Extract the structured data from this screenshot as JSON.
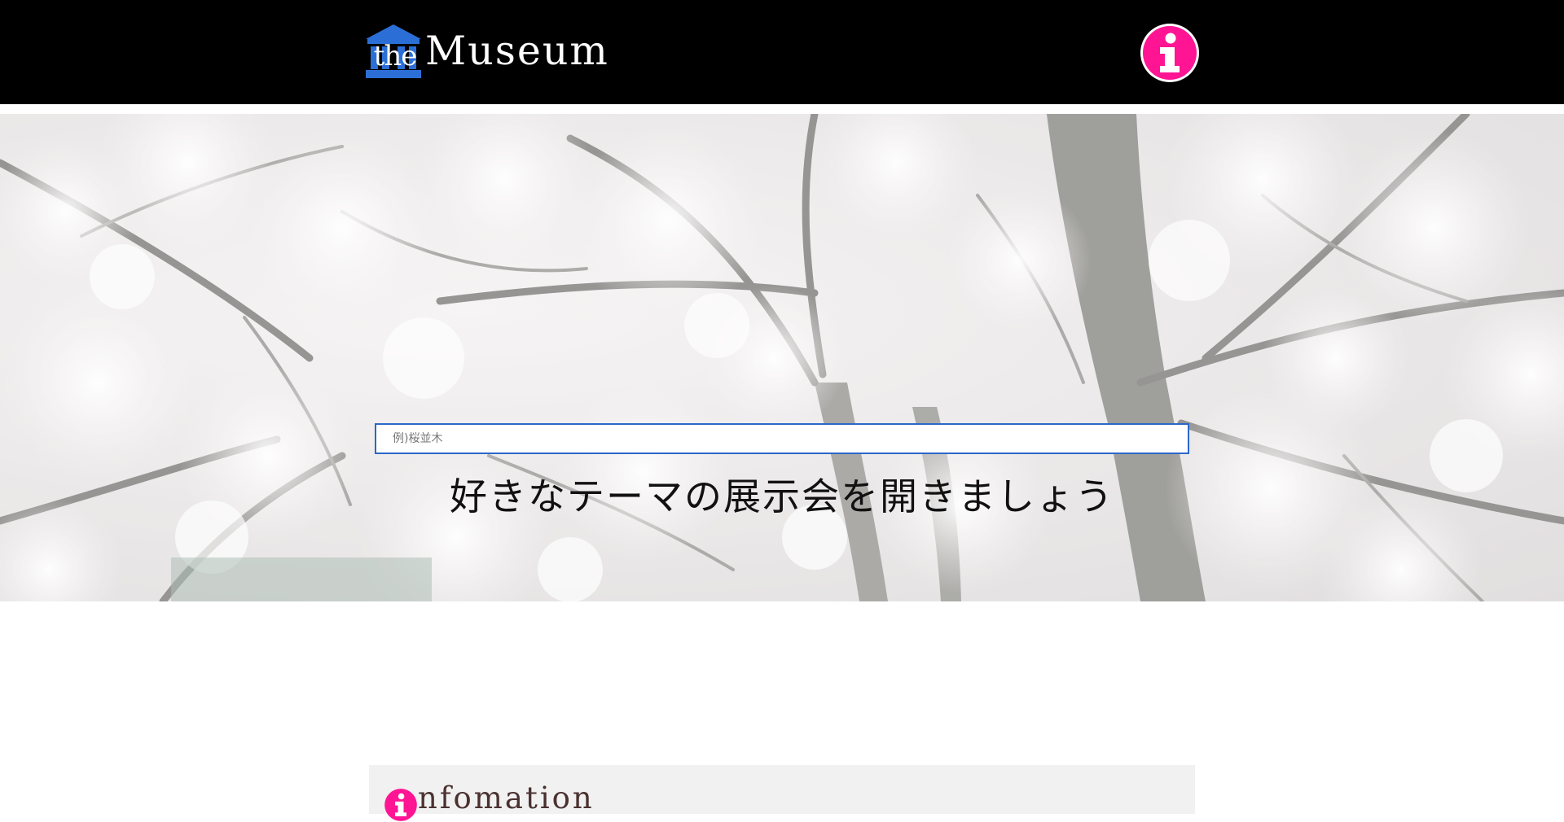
{
  "header": {
    "logo": {
      "prefix": "the",
      "name": "Museum",
      "icon": "museum-building-icon",
      "icon_color": "#2b6fd6"
    },
    "info_button": {
      "icon": "info-icon",
      "color": "#ff1493"
    }
  },
  "hero": {
    "background": "cherry-blossom-photo",
    "search": {
      "placeholder": "例)桜並木",
      "value": ""
    },
    "tagline": "好きなテーマの展示会を開きましょう"
  },
  "info_section": {
    "heading_initial": "i",
    "heading_rest": "nfomation",
    "icon": "info-icon"
  }
}
